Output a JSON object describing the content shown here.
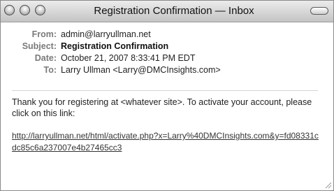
{
  "window": {
    "title": "Registration Confirmation — Inbox"
  },
  "headers": {
    "from_label": "From:",
    "from_value": "admin@larryullman.net",
    "subject_label": "Subject:",
    "subject_value": "Registration Confirmation",
    "date_label": "Date:",
    "date_value": "October 21, 2007 8:33:41 PM EDT",
    "to_label": "To:",
    "to_value": "Larry Ullman <Larry@DMCInsights.com>"
  },
  "message": {
    "body_text": "Thank you for registering at <whatever site>. To activate your account, please click on this link:",
    "activation_link": "http://larryullman.net/html/activate.php?x=Larry%40DMCInsights.com&y=fd08331cdc85c6a237007e4b27465cc3"
  },
  "icons": {
    "close": "close-button-icon",
    "minimize": "minimize-button-icon",
    "zoom": "zoom-button-icon",
    "toolbar_toggle": "toolbar-toggle-icon",
    "resize": "resize-grip-icon"
  }
}
